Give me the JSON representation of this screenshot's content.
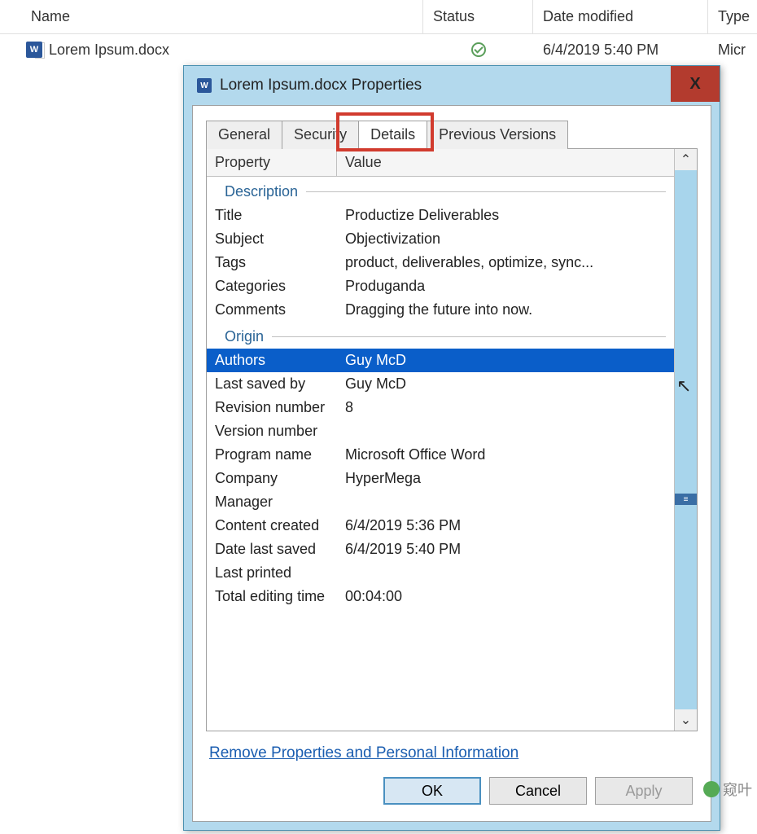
{
  "explorer": {
    "columns": {
      "name": "Name",
      "status": "Status",
      "date": "Date modified",
      "type": "Type"
    },
    "file": {
      "name": "Lorem Ipsum.docx",
      "date": "6/4/2019 5:40 PM",
      "type": "Micr"
    }
  },
  "dialog": {
    "title": "Lorem Ipsum.docx Properties",
    "close": "X",
    "tabs": {
      "general": "General",
      "security": "Security",
      "details": "Details",
      "previous": "Previous Versions"
    },
    "header": {
      "property": "Property",
      "value": "Value"
    },
    "sections": {
      "description": {
        "label": "Description",
        "rows": [
          {
            "name": "Title",
            "value": "Productize Deliverables"
          },
          {
            "name": "Subject",
            "value": "Objectivization"
          },
          {
            "name": "Tags",
            "value": "product, deliverables, optimize, sync..."
          },
          {
            "name": "Categories",
            "value": "Produganda"
          },
          {
            "name": "Comments",
            "value": "Dragging the future into now."
          }
        ]
      },
      "origin": {
        "label": "Origin",
        "rows": [
          {
            "name": "Authors",
            "value": "Guy McD",
            "selected": true
          },
          {
            "name": "Last saved by",
            "value": "Guy McD"
          },
          {
            "name": "Revision number",
            "value": "8"
          },
          {
            "name": "Version number",
            "value": ""
          },
          {
            "name": "Program name",
            "value": "Microsoft Office Word"
          },
          {
            "name": "Company",
            "value": "HyperMega"
          },
          {
            "name": "Manager",
            "value": ""
          },
          {
            "name": "Content created",
            "value": "6/4/2019 5:36 PM"
          },
          {
            "name": "Date last saved",
            "value": "6/4/2019 5:40 PM"
          },
          {
            "name": "Last printed",
            "value": ""
          },
          {
            "name": "Total editing time",
            "value": "00:04:00"
          }
        ]
      }
    },
    "remove_link": "Remove Properties and Personal Information",
    "buttons": {
      "ok": "OK",
      "cancel": "Cancel",
      "apply": "Apply"
    }
  },
  "watermark": "窥叶"
}
